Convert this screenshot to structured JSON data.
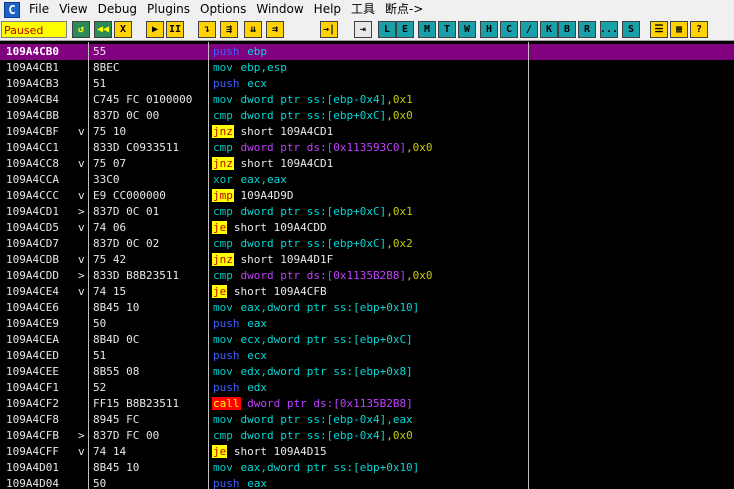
{
  "menu": {
    "app_icon_label": "C",
    "items": [
      "File",
      "View",
      "Debug",
      "Plugins",
      "Options",
      "Window",
      "Help",
      "工具",
      "断点->"
    ]
  },
  "toolbar": {
    "status": "Paused",
    "buttons": [
      {
        "icon": "open-icon",
        "glyph": "↺",
        "color": "g"
      },
      {
        "icon": "rewind-icon",
        "glyph": "◀◀",
        "color": "g"
      },
      {
        "icon": "close-icon",
        "glyph": "X",
        "color": "y"
      },
      {
        "icon": "run-icon",
        "glyph": "▶",
        "color": "y"
      },
      {
        "icon": "pause-icon",
        "glyph": "II",
        "color": "y"
      },
      {
        "icon": "step-into-icon",
        "glyph": "↴",
        "color": "y"
      },
      {
        "icon": "step-over-icon",
        "glyph": "⇶",
        "color": "y"
      },
      {
        "icon": "trace-into-icon",
        "glyph": "⇊",
        "color": "y"
      },
      {
        "icon": "trace-over-icon",
        "glyph": "⇉",
        "color": "y"
      },
      {
        "icon": "execute-till-return-icon",
        "glyph": "→|",
        "color": "y"
      },
      {
        "icon": "goto-icon",
        "glyph": "⇥",
        "color": "w"
      },
      {
        "icon": "log-icon",
        "glyph": "L",
        "color": "c"
      },
      {
        "icon": "modules-icon",
        "glyph": "E",
        "color": "c"
      },
      {
        "icon": "memory-icon",
        "glyph": "M",
        "color": "c"
      },
      {
        "icon": "threads-icon",
        "glyph": "T",
        "color": "c"
      },
      {
        "icon": "windows-icon",
        "glyph": "W",
        "color": "c"
      },
      {
        "icon": "handles-icon",
        "glyph": "H",
        "color": "c"
      },
      {
        "icon": "cpu-icon",
        "glyph": "C",
        "color": "c"
      },
      {
        "icon": "patches-icon",
        "glyph": "/",
        "color": "c"
      },
      {
        "icon": "call-stack-icon",
        "glyph": "K",
        "color": "c"
      },
      {
        "icon": "breakpoints-icon",
        "glyph": "B",
        "color": "c"
      },
      {
        "icon": "references-icon",
        "glyph": "R",
        "color": "c"
      },
      {
        "icon": "run-trace-icon",
        "glyph": "...",
        "color": "c"
      },
      {
        "icon": "source-icon",
        "glyph": "S",
        "color": "c"
      },
      {
        "icon": "options-icon",
        "glyph": "☰",
        "color": "y"
      },
      {
        "icon": "appearance-icon",
        "glyph": "▦",
        "color": "y"
      },
      {
        "icon": "help-icon",
        "glyph": "?",
        "color": "y"
      }
    ]
  },
  "disasm": {
    "rows": [
      {
        "addr": "109A4CB0",
        "arrow": "",
        "hex": "55",
        "asm": [
          {
            "t": "push",
            "c": "blue mn"
          },
          {
            "t": " ebp",
            "c": "op"
          }
        ],
        "selected": true
      },
      {
        "addr": "109A4CB1",
        "arrow": "",
        "hex": "8BEC",
        "asm": [
          {
            "t": "mov",
            "c": "teal mn"
          },
          {
            "t": " ebp,esp",
            "c": "op"
          }
        ]
      },
      {
        "addr": "109A4CB3",
        "arrow": "",
        "hex": "51",
        "asm": [
          {
            "t": "push",
            "c": "blue mn"
          },
          {
            "t": " ecx",
            "c": "op"
          }
        ]
      },
      {
        "addr": "109A4CB4",
        "arrow": "",
        "hex": "C745 FC 0100000",
        "asm": [
          {
            "t": "mov",
            "c": "teal mn"
          },
          {
            "t": " dword ptr ss:[ebp-0x4]",
            "c": "op"
          },
          {
            "t": ",0x1",
            "c": "imm"
          }
        ]
      },
      {
        "addr": "109A4CBB",
        "arrow": "",
        "hex": "837D 0C 00",
        "asm": [
          {
            "t": "cmp",
            "c": "teal mn"
          },
          {
            "t": " dword ptr ss:[ebp+0xC]",
            "c": "op"
          },
          {
            "t": ",0x0",
            "c": "imm"
          }
        ]
      },
      {
        "addr": "109A4CBF",
        "arrow": "v",
        "hex": "75 10",
        "asm": [
          {
            "t": "jnz",
            "c": "hl-y mn"
          },
          {
            "t": " short 109A4CD1",
            "c": "op flow"
          }
        ]
      },
      {
        "addr": "109A4CC1",
        "arrow": "",
        "hex": "833D C0933511",
        "asm": [
          {
            "t": "cmp",
            "c": "teal mn"
          },
          {
            "t": " dword ptr ds:[0x113593C0]",
            "c": "op mem"
          },
          {
            "t": ",0x0",
            "c": "imm"
          }
        ]
      },
      {
        "addr": "109A4CC8",
        "arrow": "v",
        "hex": "75 07",
        "asm": [
          {
            "t": "jnz",
            "c": "hl-y mn"
          },
          {
            "t": " short 109A4CD1",
            "c": "op flow"
          }
        ]
      },
      {
        "addr": "109A4CCA",
        "arrow": "",
        "hex": "33C0",
        "asm": [
          {
            "t": "xor",
            "c": "teal mn"
          },
          {
            "t": " eax,eax",
            "c": "op"
          }
        ]
      },
      {
        "addr": "109A4CCC",
        "arrow": "v",
        "hex": "E9 CC000000",
        "asm": [
          {
            "t": "jmp",
            "c": "hl-y mn"
          },
          {
            "t": " 109A4D9D",
            "c": "op flow"
          }
        ]
      },
      {
        "addr": "109A4CD1",
        "arrow": ">",
        "hex": "837D 0C 01",
        "asm": [
          {
            "t": "cmp",
            "c": "teal mn"
          },
          {
            "t": " dword ptr ss:[ebp+0xC]",
            "c": "op"
          },
          {
            "t": ",0x1",
            "c": "imm"
          }
        ]
      },
      {
        "addr": "109A4CD5",
        "arrow": "v",
        "hex": "74 06",
        "asm": [
          {
            "t": "je",
            "c": "hl-y mn"
          },
          {
            "t": " short 109A4CDD",
            "c": "op flow"
          }
        ]
      },
      {
        "addr": "109A4CD7",
        "arrow": "",
        "hex": "837D 0C 02",
        "asm": [
          {
            "t": "cmp",
            "c": "teal mn"
          },
          {
            "t": " dword ptr ss:[ebp+0xC]",
            "c": "op"
          },
          {
            "t": ",0x2",
            "c": "imm"
          }
        ]
      },
      {
        "addr": "109A4CDB",
        "arrow": "v",
        "hex": "75 42",
        "asm": [
          {
            "t": "jnz",
            "c": "hl-y mn"
          },
          {
            "t": " short 109A4D1F",
            "c": "op flow"
          }
        ]
      },
      {
        "addr": "109A4CDD",
        "arrow": ">",
        "hex": "833D B8B23511",
        "asm": [
          {
            "t": "cmp",
            "c": "teal mn"
          },
          {
            "t": " dword ptr ds:[0x1135B2B8]",
            "c": "op mem"
          },
          {
            "t": ",0x0",
            "c": "imm"
          }
        ]
      },
      {
        "addr": "109A4CE4",
        "arrow": "v",
        "hex": "74 15",
        "asm": [
          {
            "t": "je",
            "c": "hl-y mn"
          },
          {
            "t": " short 109A4CFB",
            "c": "op flow"
          }
        ]
      },
      {
        "addr": "109A4CE6",
        "arrow": "",
        "hex": "8B45 10",
        "asm": [
          {
            "t": "mov",
            "c": "teal mn"
          },
          {
            "t": " eax,dword ptr ss:[ebp+0x10]",
            "c": "op"
          }
        ]
      },
      {
        "addr": "109A4CE9",
        "arrow": "",
        "hex": "50",
        "asm": [
          {
            "t": "push",
            "c": "blue mn"
          },
          {
            "t": " eax",
            "c": "op"
          }
        ]
      },
      {
        "addr": "109A4CEA",
        "arrow": "",
        "hex": "8B4D 0C",
        "asm": [
          {
            "t": "mov",
            "c": "teal mn"
          },
          {
            "t": " ecx,dword ptr ss:[ebp+0xC]",
            "c": "op"
          }
        ]
      },
      {
        "addr": "109A4CED",
        "arrow": "",
        "hex": "51",
        "asm": [
          {
            "t": "push",
            "c": "blue mn"
          },
          {
            "t": " ecx",
            "c": "op"
          }
        ]
      },
      {
        "addr": "109A4CEE",
        "arrow": "",
        "hex": "8B55 08",
        "asm": [
          {
            "t": "mov",
            "c": "teal mn"
          },
          {
            "t": " edx,dword ptr ss:[ebp+0x8]",
            "c": "op"
          }
        ]
      },
      {
        "addr": "109A4CF1",
        "arrow": "",
        "hex": "52",
        "asm": [
          {
            "t": "push",
            "c": "blue mn"
          },
          {
            "t": " edx",
            "c": "op"
          }
        ]
      },
      {
        "addr": "109A4CF2",
        "arrow": "",
        "hex": "FF15 B8B23511",
        "asm": [
          {
            "t": "call",
            "c": "hl-r mn"
          },
          {
            "t": " dword ptr ds:[0x1135B2B8]",
            "c": "op mem"
          }
        ]
      },
      {
        "addr": "109A4CF8",
        "arrow": "",
        "hex": "8945 FC",
        "asm": [
          {
            "t": "mov",
            "c": "teal mn"
          },
          {
            "t": " dword ptr ss:[ebp-0x4],eax",
            "c": "op"
          }
        ]
      },
      {
        "addr": "109A4CFB",
        "arrow": ">",
        "hex": "837D FC 00",
        "asm": [
          {
            "t": "cmp",
            "c": "teal mn"
          },
          {
            "t": " dword ptr ss:[ebp-0x4]",
            "c": "op"
          },
          {
            "t": ",0x0",
            "c": "imm"
          }
        ]
      },
      {
        "addr": "109A4CFF",
        "arrow": "v",
        "hex": "74 14",
        "asm": [
          {
            "t": "je",
            "c": "hl-y mn"
          },
          {
            "t": " short 109A4D15",
            "c": "op flow"
          }
        ]
      },
      {
        "addr": "109A4D01",
        "arrow": "",
        "hex": "8B45 10",
        "asm": [
          {
            "t": "mov",
            "c": "teal mn"
          },
          {
            "t": " eax,dword ptr ss:[ebp+0x10]",
            "c": "op"
          }
        ]
      },
      {
        "addr": "109A4D04",
        "arrow": "",
        "hex": "50",
        "asm": [
          {
            "t": "push",
            "c": "blue mn"
          },
          {
            "t": " eax",
            "c": "op"
          }
        ]
      }
    ]
  }
}
